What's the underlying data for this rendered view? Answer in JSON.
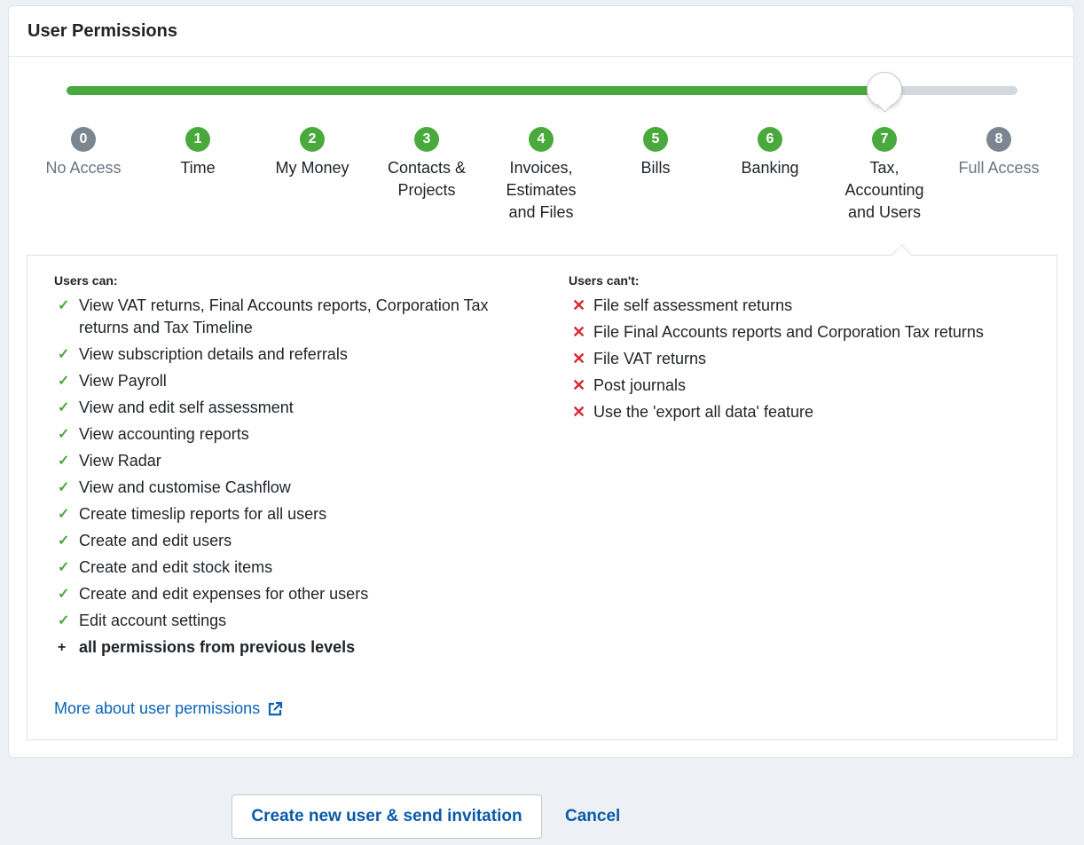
{
  "card": {
    "title": "User Permissions"
  },
  "slider": {
    "selected_level": 7,
    "max_level": 8
  },
  "levels": [
    {
      "number": "0",
      "label": "No Access",
      "state": "muted"
    },
    {
      "number": "1",
      "label": "Time",
      "state": "active"
    },
    {
      "number": "2",
      "label": "My Money",
      "state": "active"
    },
    {
      "number": "3",
      "label": "Contacts &\nProjects",
      "state": "active"
    },
    {
      "number": "4",
      "label": "Invoices,\nEstimates\nand Files",
      "state": "active"
    },
    {
      "number": "5",
      "label": "Bills",
      "state": "active"
    },
    {
      "number": "6",
      "label": "Banking",
      "state": "active"
    },
    {
      "number": "7",
      "label": "Tax,\nAccounting\nand Users",
      "state": "active"
    },
    {
      "number": "8",
      "label": "Full Access",
      "state": "muted"
    }
  ],
  "panel": {
    "can_heading": "Users can:",
    "can_items": [
      "View VAT returns, Final Accounts reports, Corporation Tax returns and Tax Timeline",
      "View subscription details and referrals",
      "View Payroll",
      "View and edit self assessment",
      "View accounting reports",
      "View Radar",
      "View and customise Cashflow",
      "Create timeslip reports for all users",
      "Create and edit users",
      "Create and edit stock items",
      "Create and edit expenses for other users",
      "Edit account settings"
    ],
    "can_extra": "all permissions from previous levels",
    "cant_heading": "Users can't:",
    "cant_items": [
      "File self assessment returns",
      "File Final Accounts reports and Corporation Tax returns",
      "File VAT returns",
      "Post journals",
      "Use the 'export all data' feature"
    ],
    "more_link": "More about user permissions"
  },
  "actions": {
    "create_label": "Create new user & send invitation",
    "cancel_label": "Cancel"
  },
  "colors": {
    "accent_green": "#4aa93c",
    "muted_gray": "#7c8690",
    "link_blue": "#0a63b8",
    "cross_red": "#d9282f"
  },
  "icons": {
    "can": "check-icon",
    "cant": "cross-icon",
    "extra": "plus-icon",
    "link": "external-link-icon"
  }
}
